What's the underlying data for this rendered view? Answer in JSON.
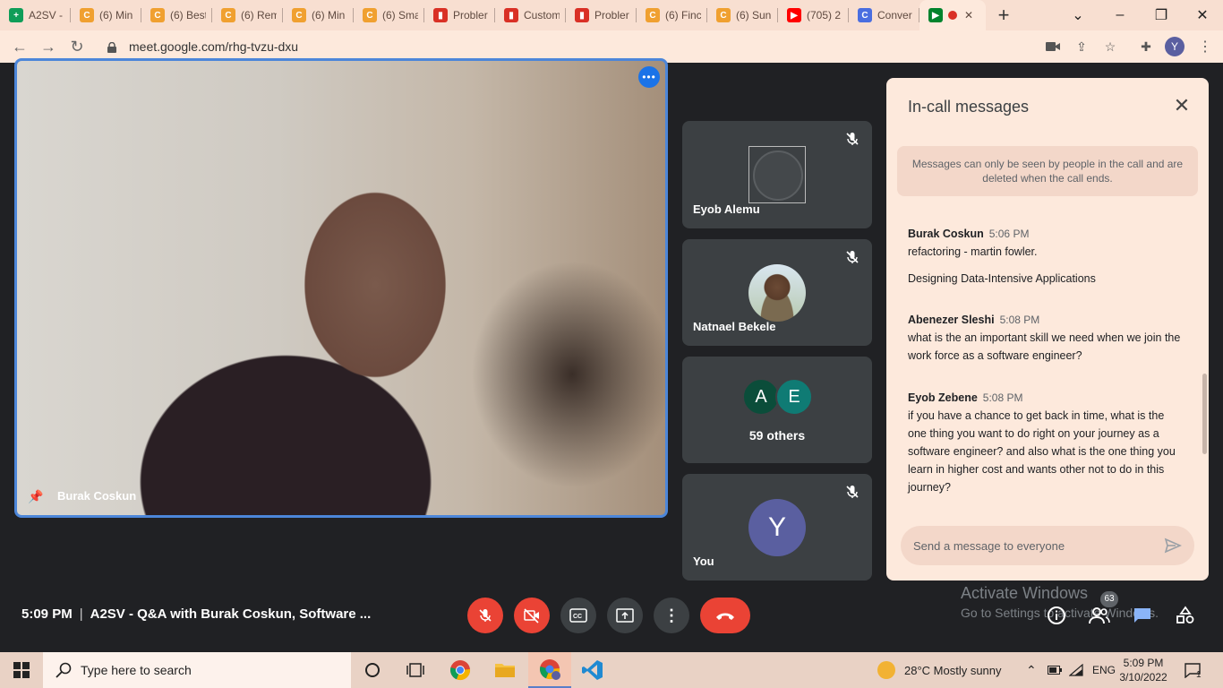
{
  "browser": {
    "tabs": [
      {
        "title": "A2SV -",
        "favicon_color": "#0f9d58",
        "favicon_char": "+"
      },
      {
        "title": "(6) Min",
        "favicon_color": "#f0a030",
        "favicon_char": "C"
      },
      {
        "title": "(6) Best",
        "favicon_color": "#f0a030",
        "favicon_char": "C"
      },
      {
        "title": "(6) Rem",
        "favicon_color": "#f0a030",
        "favicon_char": "C"
      },
      {
        "title": "(6) Min",
        "favicon_color": "#f0a030",
        "favicon_char": "C"
      },
      {
        "title": "(6) Sma",
        "favicon_color": "#f0a030",
        "favicon_char": "C"
      },
      {
        "title": "Probler",
        "favicon_color": "#d93025",
        "favicon_char": "▮"
      },
      {
        "title": "Custom",
        "favicon_color": "#d93025",
        "favicon_char": "▮"
      },
      {
        "title": "Probler",
        "favicon_color": "#d93025",
        "favicon_char": "▮"
      },
      {
        "title": "(6) Finc",
        "favicon_color": "#f0a030",
        "favicon_char": "C"
      },
      {
        "title": "(6) Sun",
        "favicon_color": "#f0a030",
        "favicon_char": "C"
      },
      {
        "title": "(705) 2",
        "favicon_color": "#ff0000",
        "favicon_char": "▶"
      },
      {
        "title": "Conver",
        "favicon_color": "#4a6ee0",
        "favicon_char": "C"
      }
    ],
    "url": "meet.google.com/rhg-tvzu-dxu",
    "profile_initial": "Y"
  },
  "meeting": {
    "main_speaker": "Burak Coskun",
    "time": "5:09 PM",
    "title": "A2SV - Q&A with Burak Coskun, Software ...",
    "participants": [
      {
        "name": "Eyob Alemu",
        "muted": true
      },
      {
        "name": "Natnael Bekele",
        "muted": true
      },
      {
        "name": "59 others",
        "initials": [
          "A",
          "E"
        ]
      },
      {
        "name": "You",
        "initial": "Y",
        "muted": true
      }
    ]
  },
  "chat": {
    "heading": "In-call messages",
    "notice": "Messages can only be seen by people in the call and are deleted when the call ends.",
    "messages": [
      {
        "sender": "Burak Coskun",
        "time": "5:06 PM",
        "lines": [
          "refactoring - martin fowler.",
          "Designing Data-Intensive Applications"
        ]
      },
      {
        "sender": "Abenezer Sleshi",
        "time": "5:08 PM",
        "text": "what is the an important skill we need when we join the work force as a software engineer?"
      },
      {
        "sender": "Eyob Zebene",
        "time": "5:08 PM",
        "text": "if you have a chance to get back in time, what is the one thing you want to do right on your journey as a software engineer? and also what is the one thing you learn in higher cost and wants other not to do in this journey?"
      }
    ],
    "input_placeholder": "Send a message to everyone"
  },
  "watermark": {
    "line1": "Activate Windows",
    "line2": "Go to Settings to activate Windows."
  },
  "people_badge": "63",
  "taskbar": {
    "search_placeholder": "Type here to search",
    "weather": "28°C  Mostly sunny",
    "lang": "ENG",
    "clock_time": "5:09 PM",
    "clock_date": "3/10/2022",
    "notif_count": "1"
  },
  "colors": {
    "accent": "#1a73e8",
    "danger": "#ea4335",
    "tile_bg": "#3c4043",
    "chat_bg": "#fde9dc"
  }
}
